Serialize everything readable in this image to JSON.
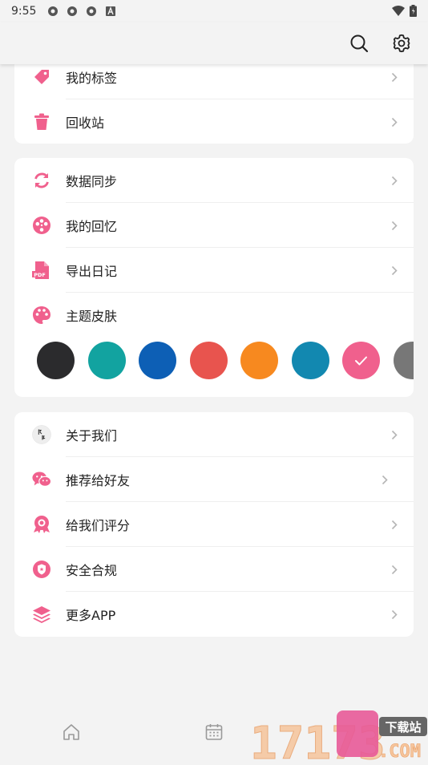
{
  "status_bar": {
    "time": "9:55"
  },
  "menu_group_1": [
    {
      "label": "我的标签",
      "icon": "tag-icon"
    },
    {
      "label": "回收站",
      "icon": "trash-icon"
    }
  ],
  "menu_group_2": [
    {
      "label": "数据同步",
      "icon": "sync-icon"
    },
    {
      "label": "我的回忆",
      "icon": "film-reel-icon"
    },
    {
      "label": "导出日记",
      "icon": "pdf-file-icon",
      "icon_text": "PDF"
    },
    {
      "label": "主题皮肤",
      "icon": "palette-icon"
    }
  ],
  "theme_colors": [
    "#2b2b2d",
    "#12a3a0",
    "#0d5fb5",
    "#e8544e",
    "#f7891f",
    "#1288b0",
    "#f0608d",
    "#777777"
  ],
  "selected_theme_index": 6,
  "menu_group_3": [
    {
      "label": "关于我们",
      "icon": "app-logo-icon"
    },
    {
      "label": "推荐给好友",
      "icon": "wechat-icon"
    },
    {
      "label": "给我们评分",
      "icon": "rating-badge-icon"
    },
    {
      "label": "安全合规",
      "icon": "shield-icon"
    },
    {
      "label": "更多APP",
      "icon": "layers-icon"
    }
  ],
  "accent_color": "#f0608d",
  "watermark": {
    "number": "17173",
    "site": "下载站",
    "domain": ".COM"
  }
}
